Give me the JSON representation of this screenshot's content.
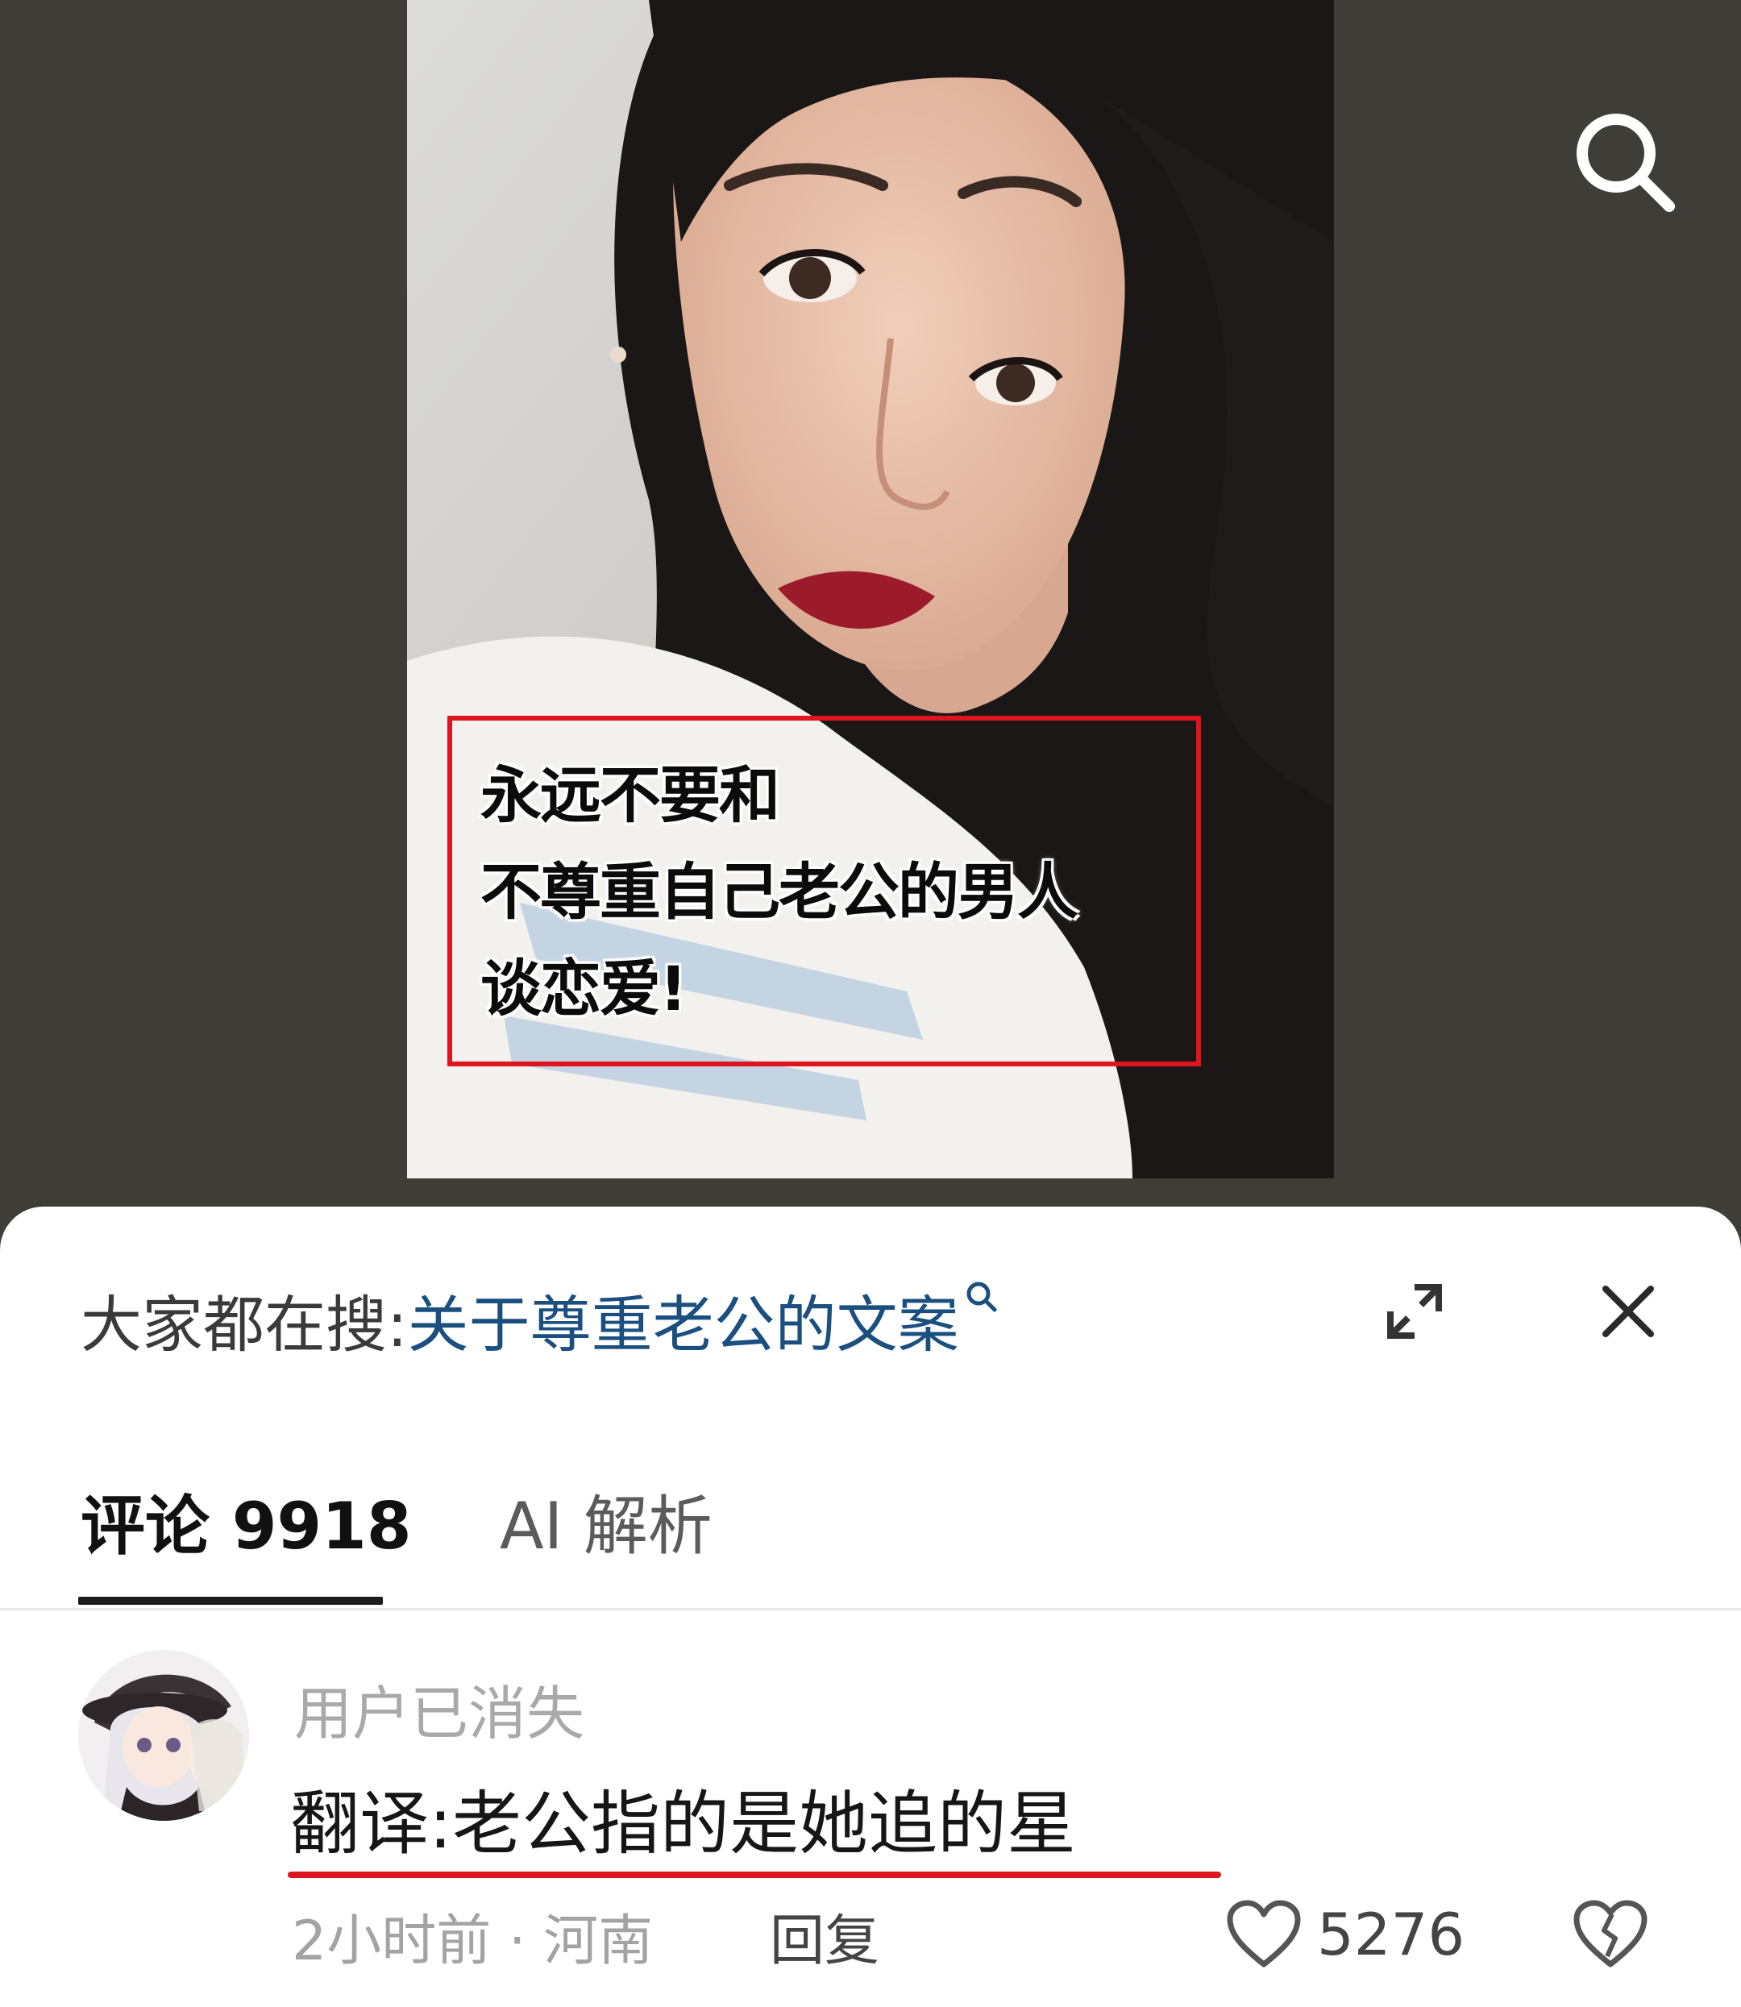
{
  "video": {
    "caption_lines": [
      "永远不要和",
      "不尊重自己老公的男人",
      "谈恋爱!"
    ]
  },
  "icons": {
    "search": "search-icon",
    "expand": "expand-icon",
    "close": "close-icon",
    "like": "heart-icon",
    "dislike": "broken-heart-icon"
  },
  "hot_search": {
    "prefix": "大家都在搜:",
    "query": "关于尊重老公的文案"
  },
  "tabs": [
    {
      "label": "评论 9918",
      "active": true
    },
    {
      "label": "AI 解析",
      "active": false
    }
  ],
  "comment": {
    "username": "用户已消失",
    "text": "翻译:老公指的是她追的星",
    "meta": "2小时前 · 河南",
    "reply_label": "回复",
    "like_count": "5276"
  },
  "colors": {
    "caption_highlight": "#e0141e",
    "link_blue": "#1a4f80",
    "backdrop": "#3f3d37"
  }
}
